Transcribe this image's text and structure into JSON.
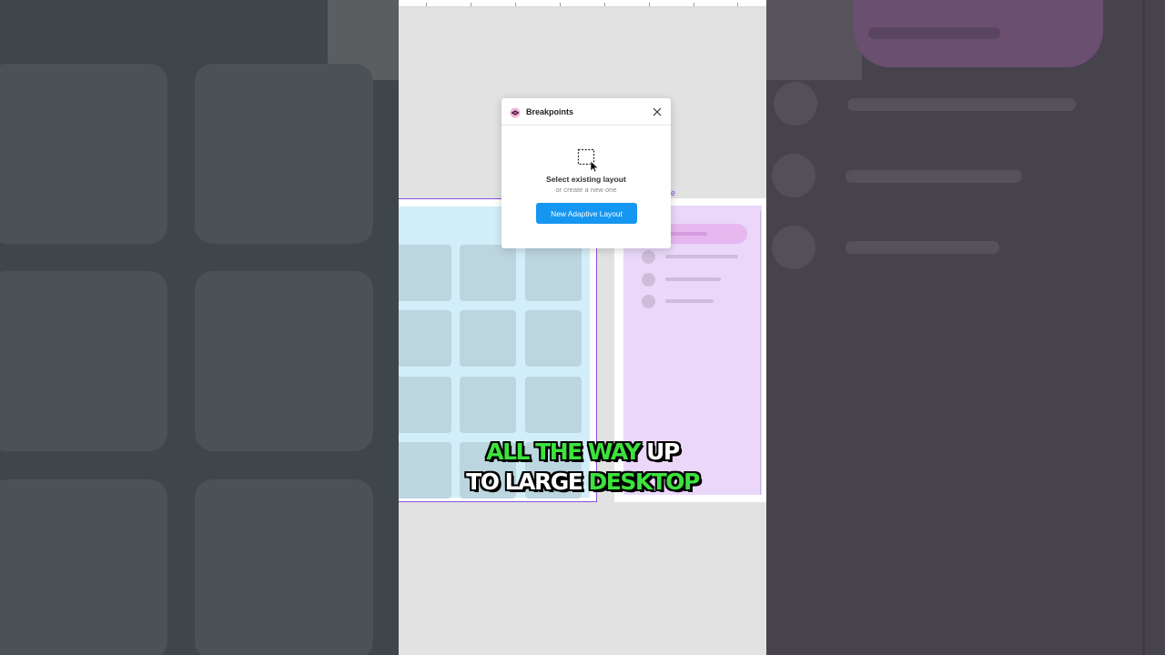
{
  "dialog": {
    "title": "Breakpoints",
    "empty_state_title": "Select existing layout",
    "empty_state_subtitle": "or create a new one",
    "primary_button_label": "New Adaptive Layout",
    "icons": [
      "breakpoints-logo-icon",
      "close-icon",
      "dashed-selection-cursor-icon"
    ]
  },
  "canvas": {
    "frame_label_fragment": "re"
  },
  "caption": {
    "line1_highlight": "ALL THE WAY",
    "line1_rest": " UP",
    "line2_start": "TO LARGE ",
    "line2_highlight": "DESKTOP"
  },
  "colors": {
    "accent_blue": "#1596f0",
    "frame_purple": "#8a4fd9",
    "caption_highlight": "#3de23d",
    "tablet_bg": "#d2eef9",
    "desktop_bg": "#ead7f9"
  }
}
